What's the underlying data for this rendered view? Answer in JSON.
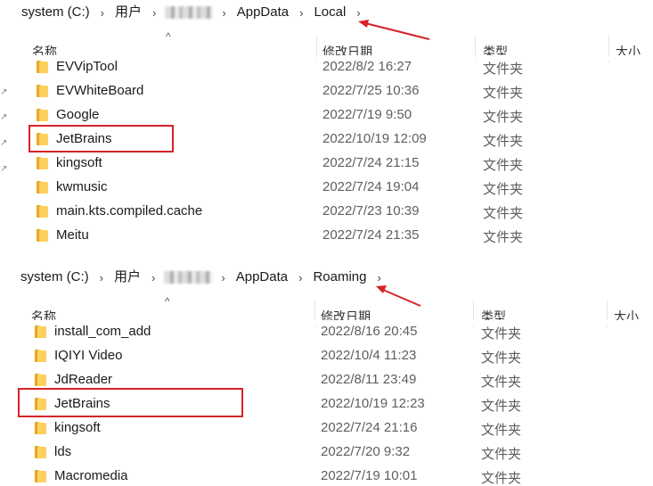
{
  "top": {
    "breadcrumb": {
      "items": [
        "system (C:)",
        "用户",
        "AppData",
        "Local"
      ]
    },
    "columns": {
      "name": "名称",
      "date": "修改日期",
      "type": "类型",
      "size": "大小"
    },
    "rows": [
      {
        "name": "EVVipTool",
        "date": "2022/8/2 16:27",
        "type": "文件夹"
      },
      {
        "name": "EVWhiteBoard",
        "date": "2022/7/25 10:36",
        "type": "文件夹"
      },
      {
        "name": "Google",
        "date": "2022/7/19 9:50",
        "type": "文件夹"
      },
      {
        "name": "JetBrains",
        "date": "2022/10/19 12:09",
        "type": "文件夹"
      },
      {
        "name": "kingsoft",
        "date": "2022/7/24 21:15",
        "type": "文件夹"
      },
      {
        "name": "kwmusic",
        "date": "2022/7/24 19:04",
        "type": "文件夹"
      },
      {
        "name": "main.kts.compiled.cache",
        "date": "2022/7/23 10:39",
        "type": "文件夹"
      },
      {
        "name": "Meitu",
        "date": "2022/7/24 21:35",
        "type": "文件夹"
      }
    ]
  },
  "bottom": {
    "breadcrumb": {
      "items": [
        "system (C:)",
        "用户",
        "AppData",
        "Roaming"
      ]
    },
    "columns": {
      "name": "名称",
      "date": "修改日期",
      "type": "类型",
      "size": "大小"
    },
    "rows": [
      {
        "name": "install_com_add",
        "date": "2022/8/16 20:45",
        "type": "文件夹"
      },
      {
        "name": "IQIYI Video",
        "date": "2022/10/4 11:23",
        "type": "文件夹"
      },
      {
        "name": "JdReader",
        "date": "2022/8/11 23:49",
        "type": "文件夹"
      },
      {
        "name": "JetBrains",
        "date": "2022/10/19 12:23",
        "type": "文件夹"
      },
      {
        "name": "kingsoft",
        "date": "2022/7/24 21:16",
        "type": "文件夹"
      },
      {
        "name": "lds",
        "date": "2022/7/20 9:32",
        "type": "文件夹"
      },
      {
        "name": "Macromedia",
        "date": "2022/7/19 10:01",
        "type": "文件夹"
      }
    ]
  },
  "icons": {
    "folder": "folder-icon",
    "breadcrumb_separator": "chevron-right-icon",
    "sort": "sort-up-icon",
    "pin": "pin-icon"
  },
  "colors": {
    "highlight": "#d6232a",
    "folder": "#fcd15e",
    "folder_dark": "#e8a81f"
  }
}
